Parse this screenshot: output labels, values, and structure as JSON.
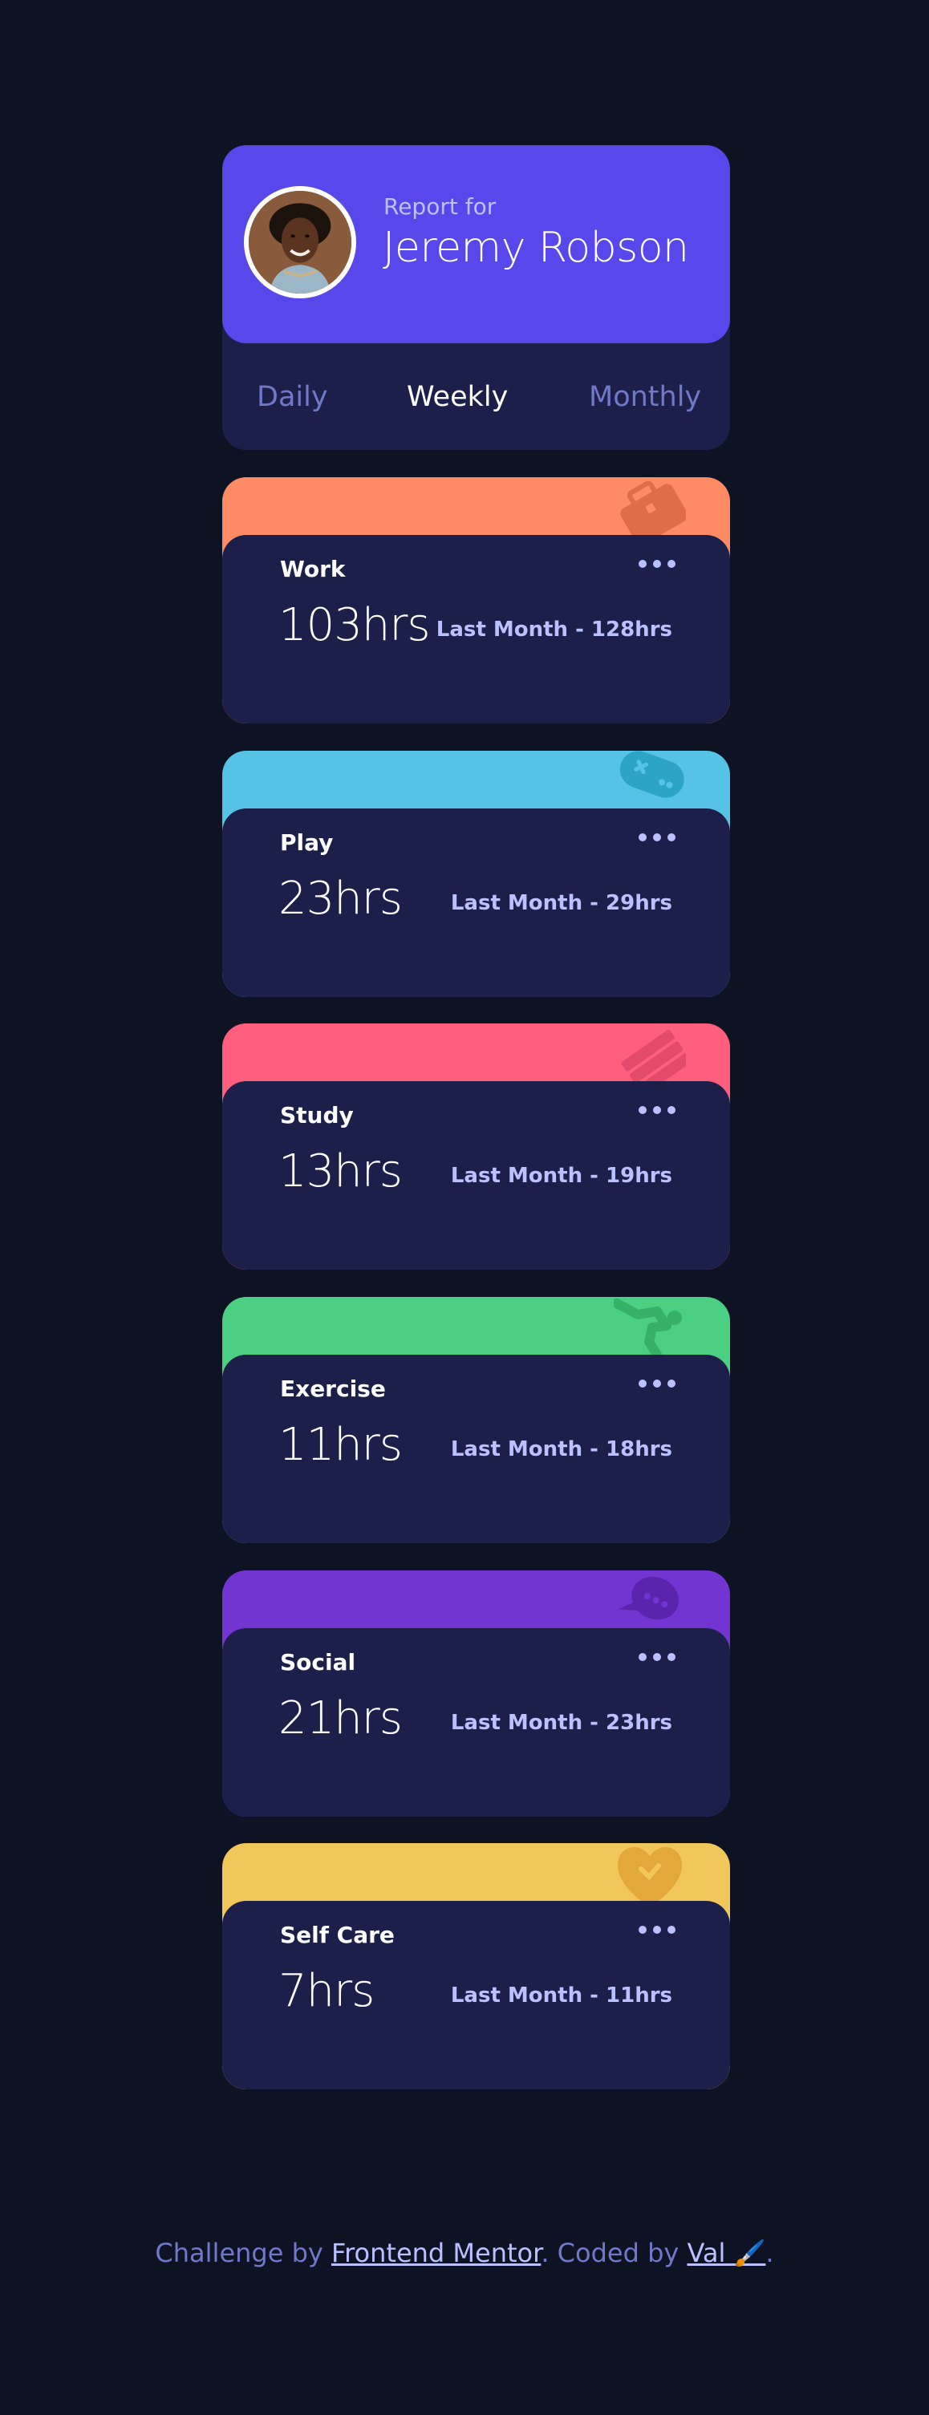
{
  "profile": {
    "report_for": "Report for",
    "name": "Jeremy Robson"
  },
  "tabs": [
    {
      "label": "Daily",
      "active": false
    },
    {
      "label": "Weekly",
      "active": true
    },
    {
      "label": "Monthly",
      "active": false
    }
  ],
  "cards": [
    {
      "title": "Work",
      "current": "103hrs",
      "previous": "Last Month - 128hrs",
      "color": "#ff8b64",
      "icon": "briefcase-icon"
    },
    {
      "title": "Play",
      "current": "23hrs",
      "previous": "Last Month - 29hrs",
      "color": "#55c2e6",
      "icon": "gamepad-icon"
    },
    {
      "title": "Study",
      "current": "13hrs",
      "previous": "Last Month - 19hrs",
      "color": "#ff5e7d",
      "icon": "book-icon"
    },
    {
      "title": "Exercise",
      "current": "11hrs",
      "previous": "Last Month - 18hrs",
      "color": "#4bcf82",
      "icon": "running-icon"
    },
    {
      "title": "Social",
      "current": "21hrs",
      "previous": "Last Month - 23hrs",
      "color": "#7335d2",
      "icon": "chat-bubble-icon"
    },
    {
      "title": "Self Care",
      "current": "7hrs",
      "previous": "Last Month - 11hrs",
      "color": "#f1c75b",
      "icon": "heart-icon"
    }
  ],
  "footer": {
    "prefix": "Challenge by ",
    "link1": "Frontend Mentor",
    "middle": ". Coded by ",
    "link2": "Val 🖌️",
    "suffix": "."
  },
  "colors": {
    "background": "#0d1323",
    "card": "#1c1f4a",
    "accent": "#5847eb",
    "muted": "#7078c9",
    "pale": "#bbc0ff"
  }
}
